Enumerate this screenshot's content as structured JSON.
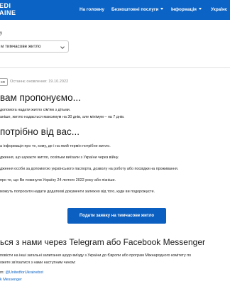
{
  "header": {
    "logo_line1": "EDI",
    "logo_line2": "AINE",
    "nav": [
      {
        "label": "На головну"
      },
      {
        "label": "Безкоштовні послуги"
      },
      {
        "label": "Інформація"
      },
      {
        "label": "Українс"
      }
    ]
  },
  "filter": {
    "label": "у",
    "selected": "м тимчасове житло"
  },
  "meta": {
    "badge": "ся",
    "updated": "Останнє оновлення: 19.10.2022"
  },
  "section1": {
    "title": "вам пропонуємо...",
    "lines": [
      "допомога надати житло сім'ям з дітьми.",
      "аніше, житло надається максимум на 30 днів, але мінімум – на 7 днів."
    ]
  },
  "section2": {
    "title": "потрібно від вас...",
    "lines": [
      "а інформація про те, кому, де і на який термін потрібне житло.",
      "дження, що шукаєте житло, оскільки виїхали з України через війну.",
      "дження особи за допомогою українського паспорта, дозволу на роботу або посвідки на проживання.",
      "про те, що Ви покинули Україну 24 лютого 2022 року або пізніше.",
      "можуть попросити надати додаткові документи залежно від того, куди ви подорожуєте."
    ]
  },
  "cta_label": "Подати заявку на тимчасове житло",
  "section3": {
    "title": "ься з нами через Telegram або Facebook Messenger",
    "line1": "повісти на інші загальні запитання щодо виїзду з України до Європи або програм Міжнародного комітету по",
    "line2": "ожете зв'язатися з нами наступним чином:",
    "telegram_prefix": "m: ",
    "telegram_handle": "@UnitedforUkrainebot",
    "messenger": "k Messenger"
  },
  "colors": {
    "brand_blue": "#0b63c5",
    "button_blue": "#0b5fc0"
  }
}
